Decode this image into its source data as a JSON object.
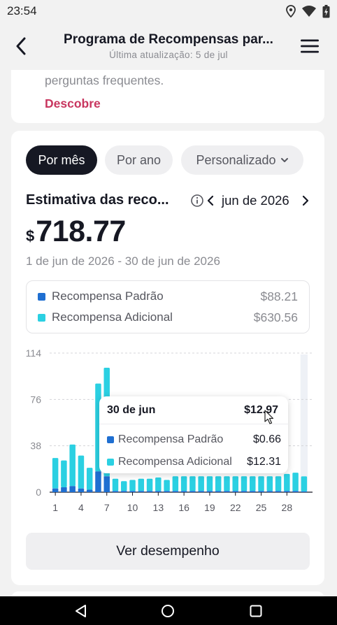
{
  "status_bar": {
    "time": "23:54"
  },
  "header": {
    "title": "Programa de Recompensas par...",
    "subtitle": "Última atualização: 5 de jul"
  },
  "top_card": {
    "faq_text": "perguntas frequentes.",
    "discover_label": "Descobre"
  },
  "filters": {
    "tabs": [
      {
        "label": "Por mês",
        "active": true
      },
      {
        "label": "Por ano",
        "active": false
      },
      {
        "label": "Personalizado",
        "active": false
      }
    ]
  },
  "estimate": {
    "title": "Estimativa das reco...",
    "month_label": "jun de 2026",
    "currency": "$",
    "amount": "718.77",
    "date_range": "1 de jun de 2026 - 30 de jun de 2026"
  },
  "legend": {
    "items": [
      {
        "label": "Recompensa Padrão",
        "value": "$88.21",
        "color": "#1f6fd1"
      },
      {
        "label": "Recompensa Adicional",
        "value": "$630.56",
        "color": "#2bd0e2"
      }
    ]
  },
  "chart_data": {
    "type": "bar",
    "stacked": true,
    "x_ticks": [
      "1",
      "4",
      "7",
      "10",
      "13",
      "16",
      "19",
      "22",
      "25",
      "28"
    ],
    "y_ticks": [
      "0",
      "38",
      "76",
      "114"
    ],
    "ylim": [
      0,
      114
    ],
    "grid": true,
    "categories": [
      1,
      2,
      3,
      4,
      5,
      6,
      7,
      8,
      9,
      10,
      11,
      12,
      13,
      14,
      15,
      16,
      17,
      18,
      19,
      20,
      21,
      22,
      23,
      24,
      25,
      26,
      27,
      28,
      29,
      30
    ],
    "series": [
      {
        "name": "Recompensa Padrão",
        "color": "#1f6fd1",
        "values": [
          3,
          4,
          5,
          3,
          2,
          17,
          13,
          1,
          1,
          1,
          1,
          1,
          1,
          1,
          1,
          1,
          1,
          1,
          1,
          1,
          1,
          1,
          1,
          1,
          1,
          1,
          1,
          1,
          1,
          0.66
        ]
      },
      {
        "name": "Recompensa Adicional",
        "color": "#2bd0e2",
        "values": [
          25,
          22,
          34,
          27,
          18,
          72,
          89,
          10,
          8,
          9,
          10,
          10,
          11,
          9,
          12,
          12,
          12,
          12,
          12,
          12,
          12,
          12,
          12,
          12,
          12,
          12,
          12,
          14,
          15,
          12.31
        ]
      }
    ],
    "highlight_index": 29
  },
  "tooltip": {
    "date": "30 de jun",
    "total": "$12.97",
    "rows": [
      {
        "label": "Recompensa Padrão",
        "value": "$0.66",
        "color": "#1f6fd1"
      },
      {
        "label": "Recompensa Adicional",
        "value": "$12.31",
        "color": "#2bd0e2"
      }
    ]
  },
  "performance_button": {
    "label": "Ver desempenho"
  }
}
